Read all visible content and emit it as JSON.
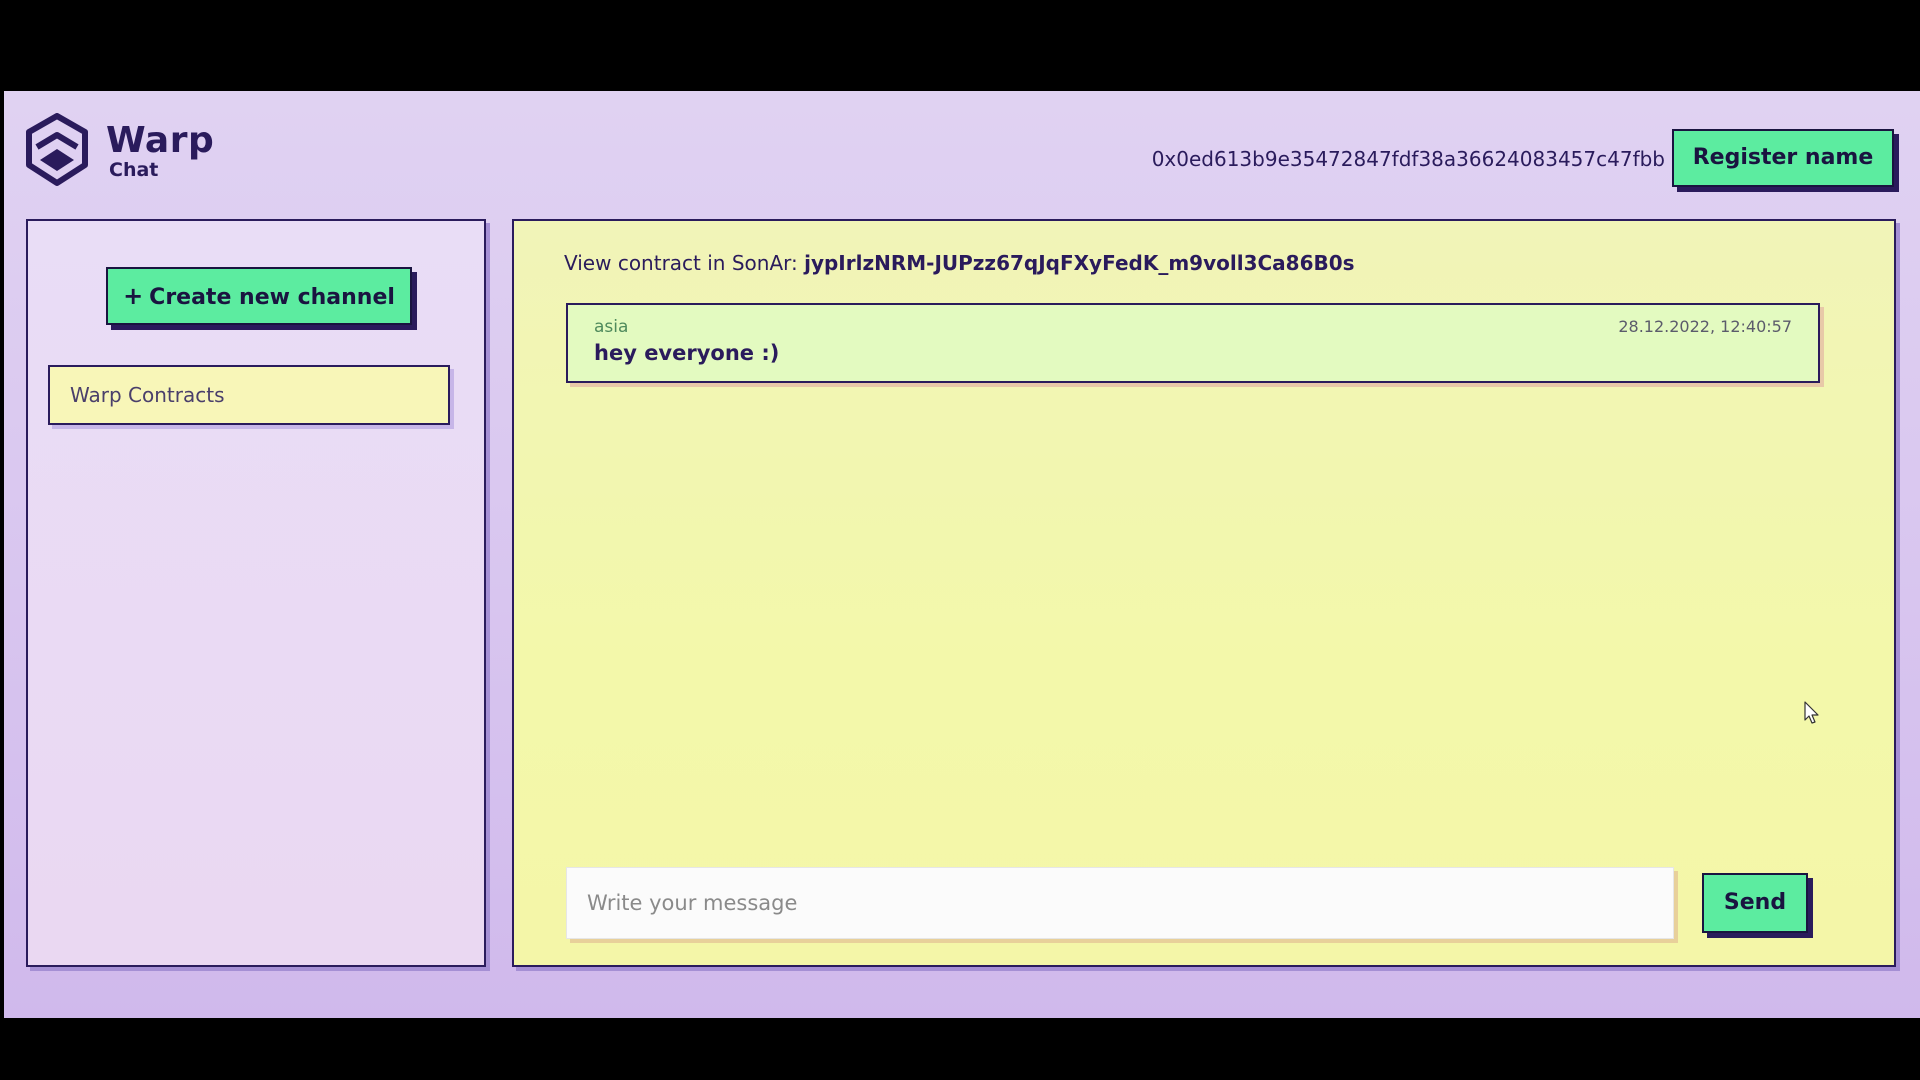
{
  "header": {
    "logo_title": "Warp",
    "logo_subtitle": "Chat",
    "wallet_address": "0x0ed613b9e35472847fdf38a36624083457c47fbb",
    "register_label": "Register name"
  },
  "sidebar": {
    "create_channel_icon": "+",
    "create_channel_label": "Create new channel",
    "channels": [
      {
        "label": "Warp Contracts"
      }
    ]
  },
  "chat": {
    "contract_prefix": "View contract in SonAr:",
    "contract_id": "jypIrlzNRM-JUPzz67qJqFXyFedK_m9voll3Ca86B0s",
    "messages": [
      {
        "author": "asia",
        "timestamp": "28.12.2022, 12:40:57",
        "text": "hey everyone :)"
      }
    ],
    "input_placeholder": "Write your message",
    "send_label": "Send"
  },
  "colors": {
    "accent_green": "#5ceca0",
    "text_dark": "#2a1b5c",
    "panel_yellow": "#f3f8aa",
    "background_lavender": "#d8c5ef"
  },
  "icons": {
    "logo": "warp-logo-icon",
    "cursor": "mouse-pointer-icon"
  }
}
